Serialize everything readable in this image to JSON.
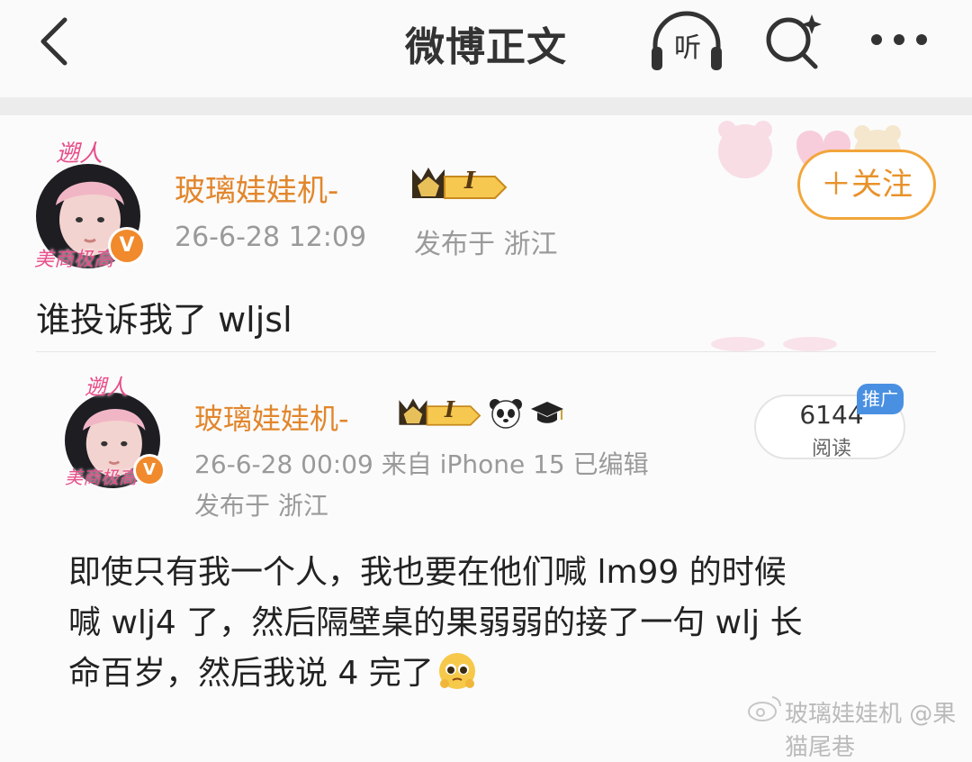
{
  "header": {
    "title": "微博正文",
    "listen_label": "听",
    "icons": [
      "back-icon",
      "listen-headphones-icon",
      "search-sparkle-icon",
      "more-icon"
    ]
  },
  "post": {
    "author": "玻璃娃娃机-",
    "level_badge": "I",
    "avatar_caption_top": "遡人",
    "avatar_caption_bottom": "美商极高",
    "verified_mark": "V",
    "time": "26-6-28 12:09",
    "location": "发布于 浙江",
    "follow_label": "＋关注",
    "text": "谁投诉我了 wljsl"
  },
  "repost": {
    "author": "玻璃娃娃机-",
    "level_badge": "I",
    "avatar_caption_top": "遡人",
    "avatar_caption_bottom": "美商极高",
    "verified_mark": "V",
    "emojis": [
      "panda-icon",
      "graduation-cap-icon"
    ],
    "time_source": "26-6-28 00:09  来自 iPhone 15  已编辑",
    "location": "发布于 浙江",
    "reads": "6144",
    "reads_label": "阅读",
    "promo_tag": "推广",
    "text_lines": [
      "即使只有我一个人，我也要在他们喊 lm99 的时候",
      "喊 wlj4 了，然后隔壁桌的果弱弱的接了一句 wlj 长",
      "命百岁，然后我说 4 完了"
    ]
  },
  "watermark": {
    "text": "玻璃娃娃机 @果猫尾巷"
  },
  "colors": {
    "accent_orange": "#e2862c",
    "follow_border": "#f2a53a",
    "meta_gray": "#9a9a9a",
    "promo_blue": "#4a90e2"
  }
}
